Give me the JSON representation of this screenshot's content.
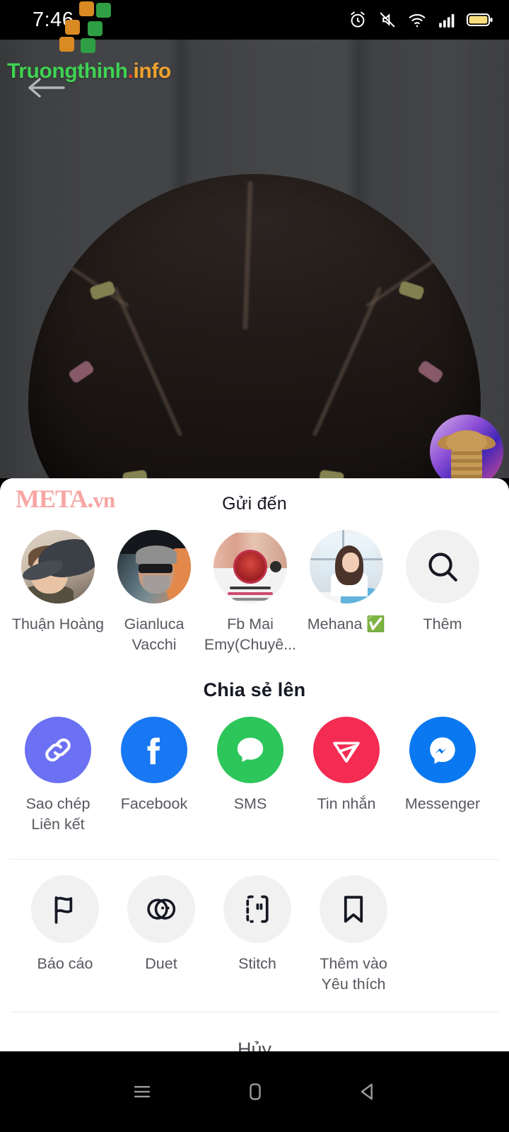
{
  "statusbar": {
    "time": "7:46",
    "icons": [
      "alarm-icon",
      "mute-icon",
      "wifi-icon",
      "signal-icon",
      "battery-icon"
    ]
  },
  "watermarks": {
    "truongthinh": {
      "green": "Truongthinh",
      "dot": ".",
      "orange": "info"
    },
    "meta": {
      "main": "META.",
      "suffix": "vn",
      "color": "#f6a6a3"
    }
  },
  "video": {
    "back_icon": "back-arrow-icon",
    "thumbnail": "video-thumbnail"
  },
  "sheet": {
    "send_to_title": "Gửi đến",
    "share_to_title": "Chia sẻ lên",
    "cancel_label": "Hủy",
    "contacts": [
      {
        "name": "Thuận Hoàng",
        "avatar": "av1"
      },
      {
        "name": "Gianluca Vacchi",
        "avatar": "av2"
      },
      {
        "name": "Fb Mai Emy(Chuyê...",
        "avatar": "av3"
      },
      {
        "name": "Mehana ✅",
        "avatar": "av4"
      },
      {
        "name": "Thêm",
        "avatar": "search"
      }
    ],
    "apps": [
      {
        "label": "Sao chép Liên kết",
        "icon": "link-icon",
        "color": "#6b71f2"
      },
      {
        "label": "Facebook",
        "icon": "facebook-icon",
        "color": "#1877f2"
      },
      {
        "label": "SMS",
        "icon": "sms-icon",
        "color": "#2dc65a"
      },
      {
        "label": "Tin nhắn",
        "icon": "direct-message-icon",
        "color": "#f42b52"
      },
      {
        "label": "Messenger",
        "icon": "messenger-icon",
        "color": "#0a78f0"
      }
    ],
    "actions": [
      {
        "label": "Báo cáo",
        "icon": "flag-icon"
      },
      {
        "label": "Duet",
        "icon": "duet-icon"
      },
      {
        "label": "Stitch",
        "icon": "stitch-icon"
      },
      {
        "label": "Thêm vào Yêu thích",
        "icon": "bookmark-icon"
      }
    ]
  },
  "navbar": {
    "recents_icon": "recents-icon",
    "home_icon": "home-icon",
    "back_icon": "back-icon"
  }
}
